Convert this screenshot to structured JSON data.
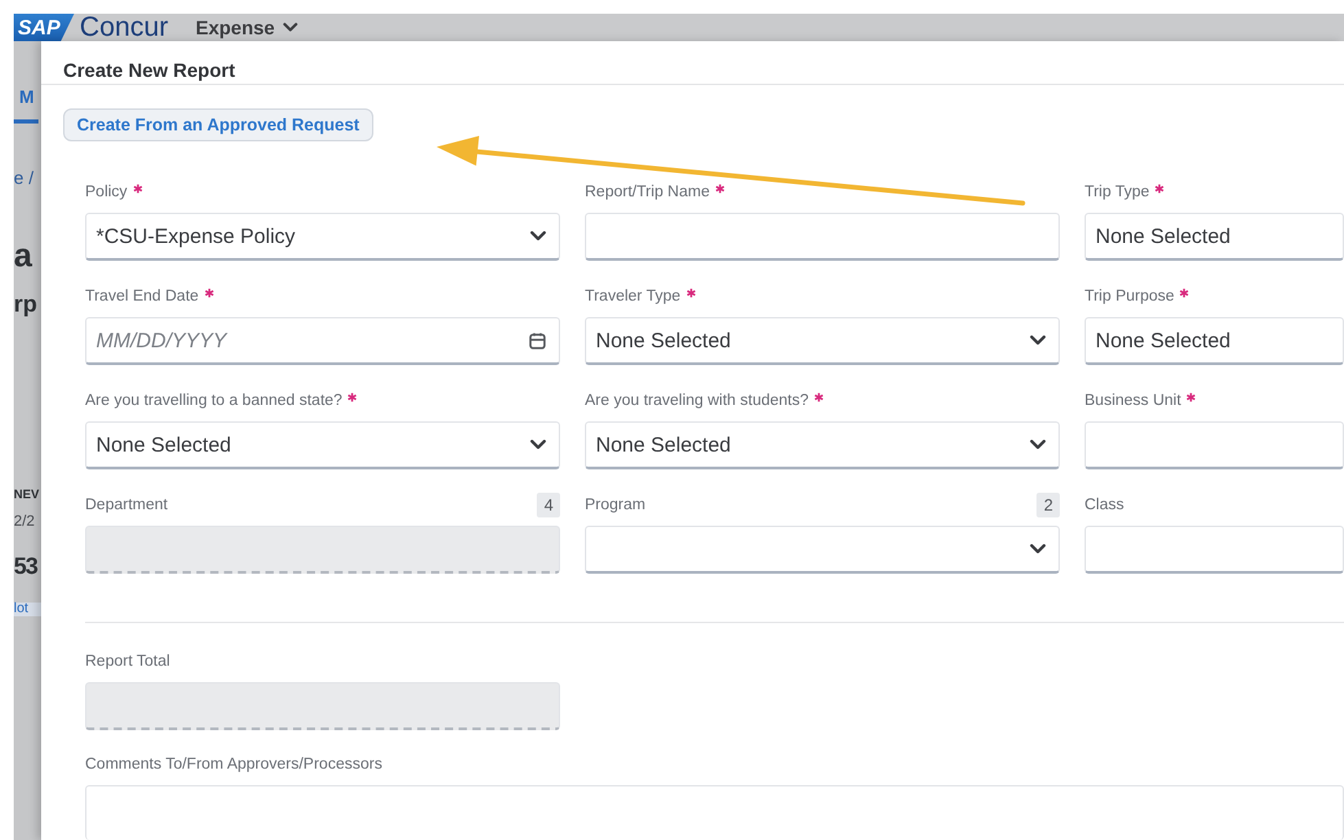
{
  "top_bar": {
    "logo": "SAP",
    "product": "Concur",
    "menu": "Expense"
  },
  "background_page": {
    "fragments": [
      {
        "kind": "tab",
        "text": "M"
      },
      {
        "kind": "breadcrumb",
        "text": "e /"
      },
      {
        "kind": "heading",
        "text": "a"
      },
      {
        "kind": "subheading",
        "text": "rp"
      },
      {
        "kind": "caption",
        "text": "NEV"
      },
      {
        "kind": "date",
        "text": "2/2"
      },
      {
        "kind": "amount",
        "text": "53"
      },
      {
        "kind": "link",
        "text": "lot"
      }
    ]
  },
  "dialog": {
    "title": "Create New Report",
    "action_button": "Create From an Approved Request",
    "fields": [
      {
        "label": "Policy",
        "required": true,
        "kind": "select",
        "value": "*CSU-Expense Policy"
      },
      {
        "label": "Report/Trip Name",
        "required": true,
        "kind": "text"
      },
      {
        "label": "Trip Type",
        "required": true,
        "kind": "text",
        "value": "None Selected"
      },
      {
        "label": "Travel End Date",
        "required": true,
        "kind": "date",
        "placeholder": "MM/DD/YYYY"
      },
      {
        "label": "Traveler Type",
        "required": true,
        "kind": "select",
        "value": "None Selected"
      },
      {
        "label": "Trip Purpose",
        "required": true,
        "kind": "text",
        "value": "None Selected"
      },
      {
        "label": "Are you travelling to a banned state?",
        "required": true,
        "kind": "select",
        "value": "None Selected"
      },
      {
        "label": "Are you traveling with students?",
        "required": true,
        "kind": "select",
        "value": "None Selected"
      },
      {
        "label": "Business Unit",
        "required": true,
        "kind": "text"
      },
      {
        "label": "Department",
        "required": false,
        "kind": "readonly",
        "count": "4"
      },
      {
        "label": "Program",
        "required": false,
        "kind": "select",
        "count": "2"
      },
      {
        "label": "Class",
        "required": false,
        "kind": "text"
      }
    ],
    "summary_fields": [
      {
        "label": "Report Total",
        "required": false,
        "kind": "readonly"
      },
      {
        "label": "Comments To/From Approvers/Processors",
        "required": false,
        "kind": "textarea"
      }
    ]
  }
}
